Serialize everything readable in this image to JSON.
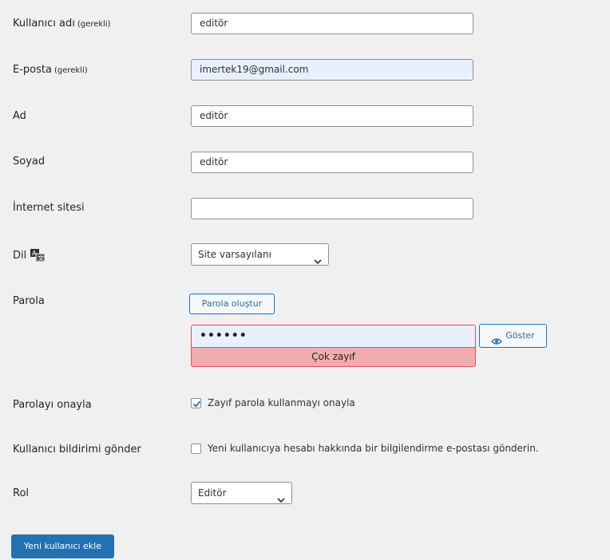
{
  "form": {
    "username": {
      "label": "Kullanıcı adı",
      "required": "(gerekli)",
      "value": "editör"
    },
    "email": {
      "label": "E-posta",
      "required": "(gerekli)",
      "value": "imertek19@gmail.com"
    },
    "first_name": {
      "label": "Ad",
      "value": "editör"
    },
    "last_name": {
      "label": "Soyad",
      "value": "editör"
    },
    "website": {
      "label": "İnternet sitesi",
      "value": ""
    },
    "language": {
      "label": "Dil",
      "icon": "translation-icon",
      "selected": "Site varsayılanı"
    },
    "password": {
      "label": "Parola",
      "generate_button": "Parola oluştur",
      "value": "••••••",
      "show_button": "Göster",
      "show_icon": "eye-icon",
      "strength": "Çok zayıf",
      "strength_color": "#f1adad"
    },
    "confirm_password": {
      "label": "Parolayı onayla",
      "checkbox_label": "Zayıf parola kullanmayı onayla",
      "checked": true
    },
    "notification": {
      "label": "Kullanıcı bildirimi gönder",
      "checkbox_label": "Yeni kullanıcıya hesabı hakkında bir bilgilendirme e-postası gönderin.",
      "checked": false
    },
    "role": {
      "label": "Rol",
      "selected": "Editör"
    },
    "submit_label": "Yeni kullanıcı ekle"
  },
  "colors": {
    "accent": "#2271b1",
    "background": "#f0f0f1",
    "weak_password": "#f1adad",
    "error_border": "#e65054"
  }
}
